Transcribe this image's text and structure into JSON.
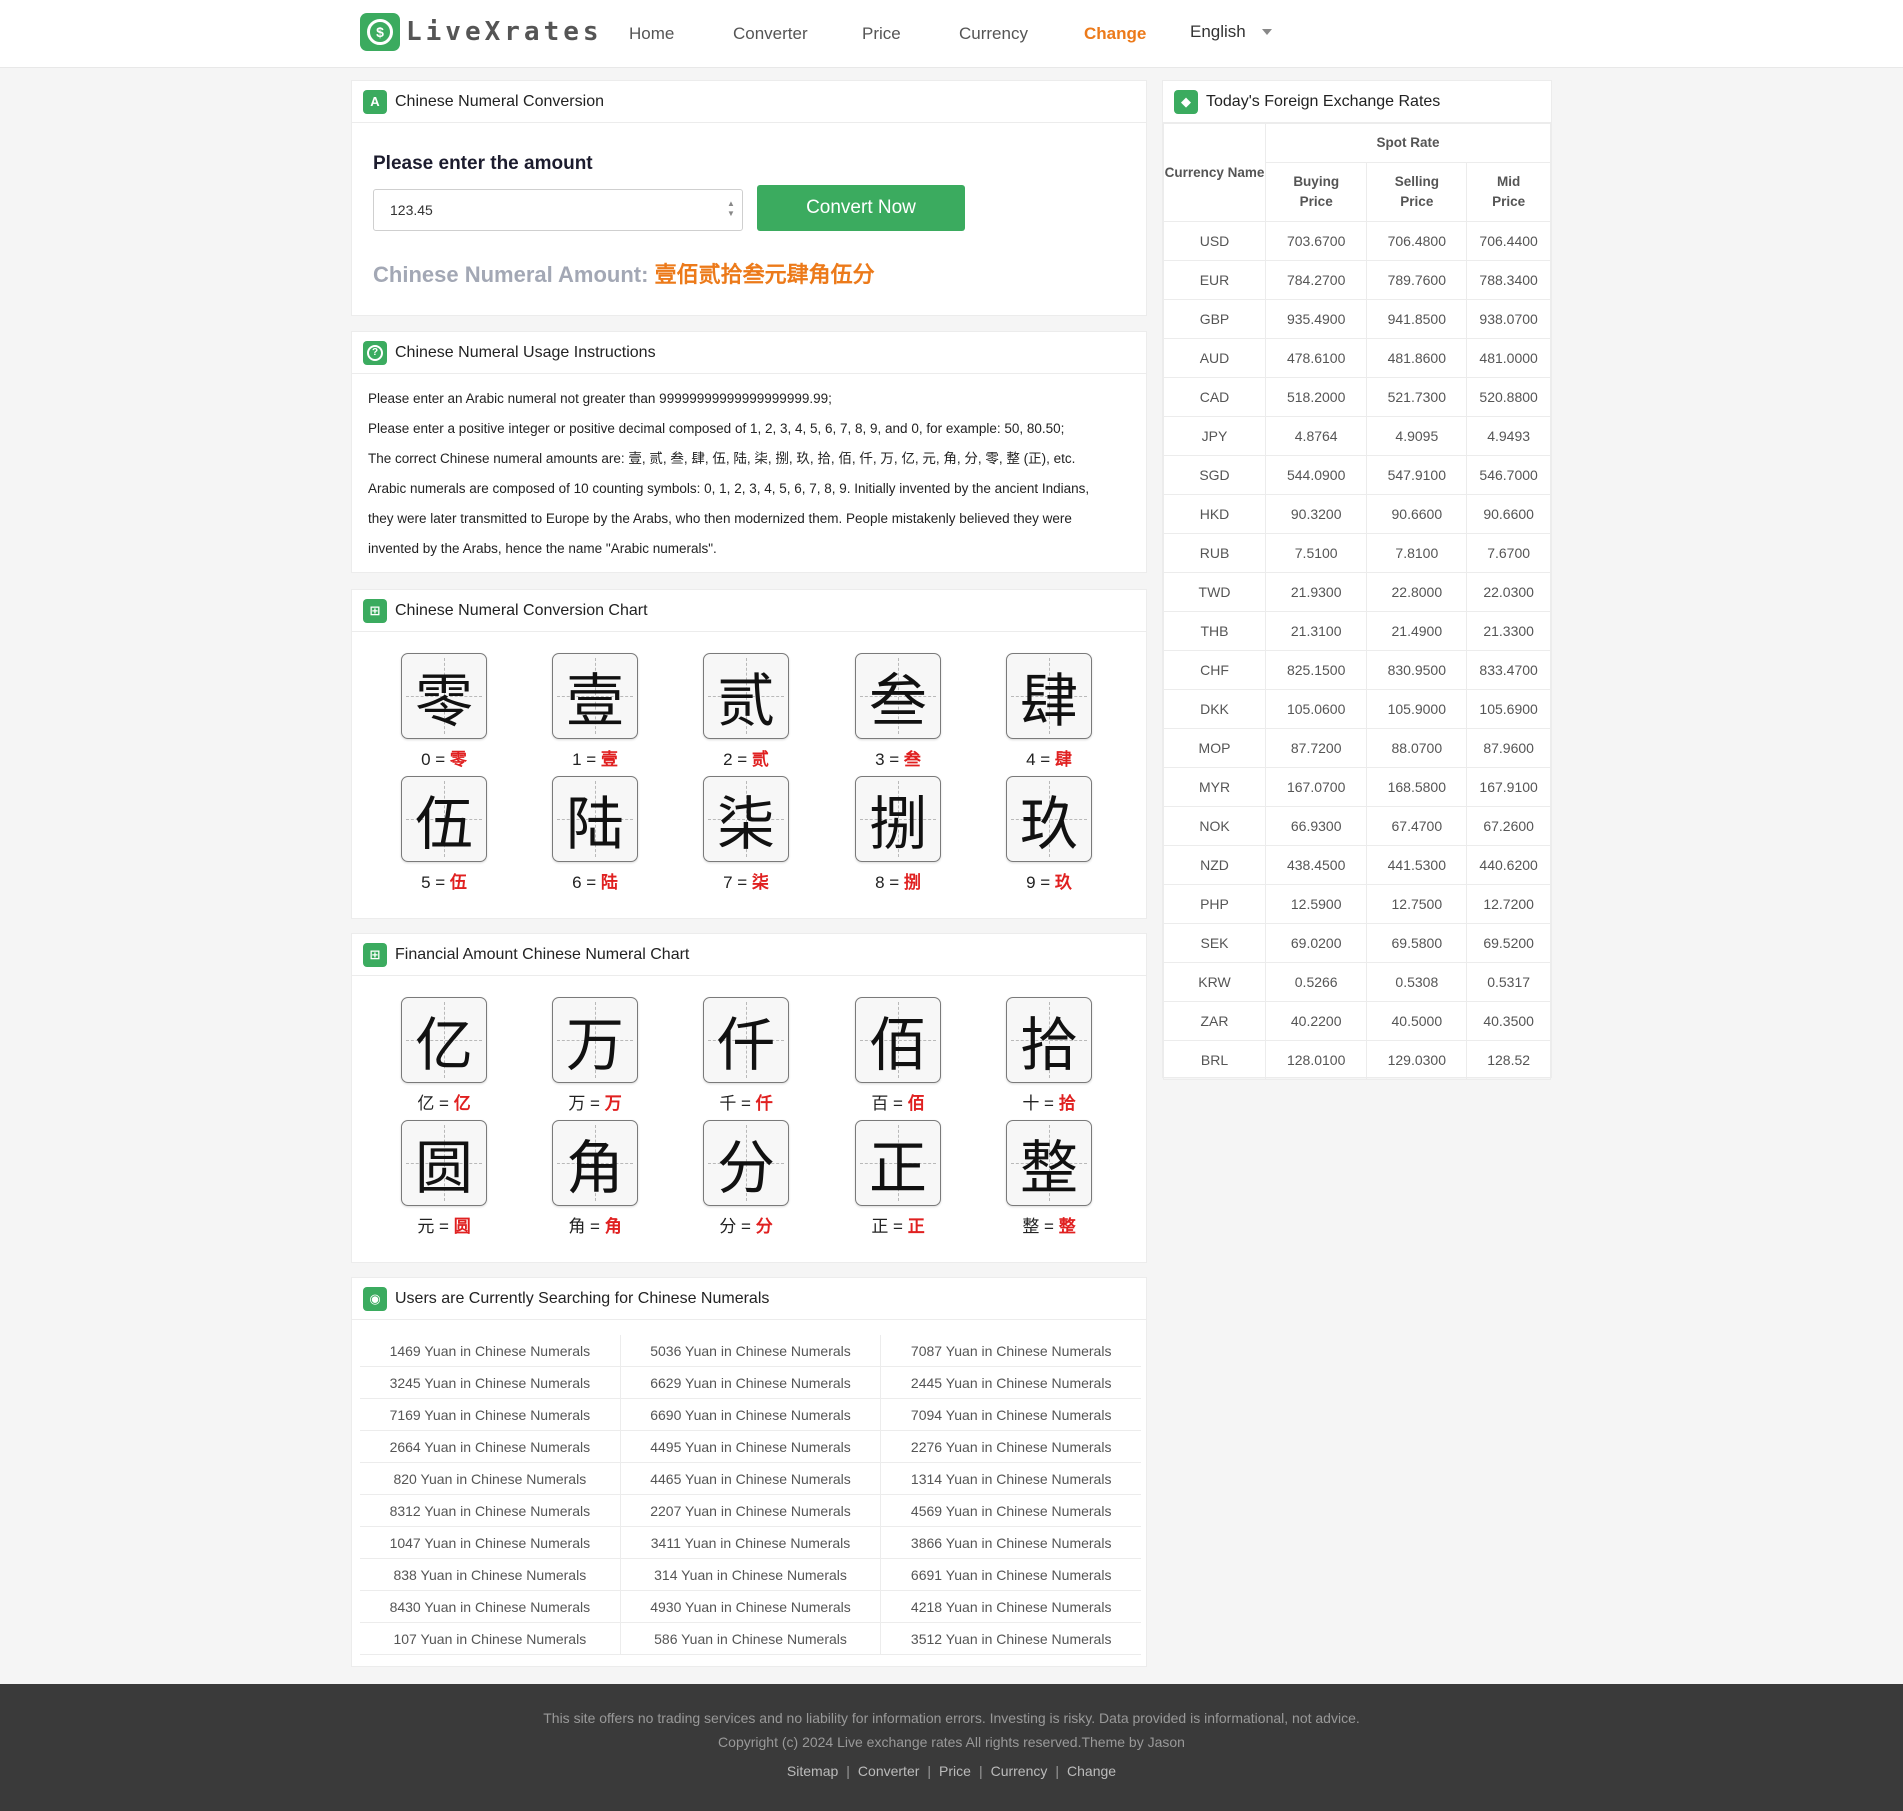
{
  "brand": {
    "name": "LiveXrates"
  },
  "nav": {
    "items": [
      {
        "label": "Home"
      },
      {
        "label": "Converter"
      },
      {
        "label": "Price"
      },
      {
        "label": "Currency"
      },
      {
        "label": "Change"
      }
    ],
    "active": "Change",
    "language": "English"
  },
  "converter": {
    "title": "Chinese Numeral Conversion",
    "prompt": "Please enter the amount",
    "input_value": "123.45",
    "button_label": "Convert Now",
    "result_label": "Chinese Numeral Amount:",
    "result_value": "壹佰贰拾叁元肆角伍分"
  },
  "instructions": {
    "title": "Chinese Numeral Usage Instructions",
    "lines": [
      "Please enter an Arabic numeral not greater than 99999999999999999999.99;",
      "Please enter a positive integer or positive decimal composed of 1, 2, 3, 4, 5, 6, 7, 8, 9, and 0, for example: 50, 80.50;",
      "The correct Chinese numeral amounts are: 壹, 贰, 叁, 肆, 伍, 陆, 柒, 捌, 玖, 拾, 佰, 仟, 万, 亿, 元, 角, 分, 零, 整 (正), etc.",
      "Arabic numerals are composed of 10 counting symbols: 0, 1, 2, 3, 4, 5, 6, 7, 8, 9. Initially invented by the ancient Indians,",
      "they were later transmitted to Europe by the Arabs, who then modernized them. People mistakenly believed they were",
      "invented by the Arabs, hence the name \"Arabic numerals\"."
    ]
  },
  "numeral_chart": {
    "title": "Chinese Numeral Conversion Chart",
    "items": [
      {
        "char": "零",
        "key": "0",
        "val": "零"
      },
      {
        "char": "壹",
        "key": "1",
        "val": "壹"
      },
      {
        "char": "贰",
        "key": "2",
        "val": "贰"
      },
      {
        "char": "叁",
        "key": "3",
        "val": "叁"
      },
      {
        "char": "肆",
        "key": "4",
        "val": "肆"
      },
      {
        "char": "伍",
        "key": "5",
        "val": "伍"
      },
      {
        "char": "陆",
        "key": "6",
        "val": "陆"
      },
      {
        "char": "柒",
        "key": "7",
        "val": "柒"
      },
      {
        "char": "捌",
        "key": "8",
        "val": "捌"
      },
      {
        "char": "玖",
        "key": "9",
        "val": "玖"
      }
    ]
  },
  "financial_chart": {
    "title": "Financial Amount Chinese Numeral Chart",
    "items": [
      {
        "char": "亿",
        "key": "亿",
        "val": "亿"
      },
      {
        "char": "万",
        "key": "万",
        "val": "万"
      },
      {
        "char": "仟",
        "key": "千",
        "val": "仟"
      },
      {
        "char": "佰",
        "key": "百",
        "val": "佰"
      },
      {
        "char": "拾",
        "key": "十",
        "val": "拾"
      },
      {
        "char": "圆",
        "key": "元",
        "val": "圆"
      },
      {
        "char": "角",
        "key": "角",
        "val": "角"
      },
      {
        "char": "分",
        "key": "分",
        "val": "分"
      },
      {
        "char": "正",
        "key": "正",
        "val": "正"
      },
      {
        "char": "整",
        "key": "整",
        "val": "整"
      }
    ]
  },
  "searches": {
    "title": "Users are Currently Searching for Chinese Numerals",
    "rows": [
      [
        "1469 Yuan in Chinese Numerals",
        "5036 Yuan in Chinese Numerals",
        "7087 Yuan in Chinese Numerals"
      ],
      [
        "3245 Yuan in Chinese Numerals",
        "6629 Yuan in Chinese Numerals",
        "2445 Yuan in Chinese Numerals"
      ],
      [
        "7169 Yuan in Chinese Numerals",
        "6690 Yuan in Chinese Numerals",
        "7094 Yuan in Chinese Numerals"
      ],
      [
        "2664 Yuan in Chinese Numerals",
        "4495 Yuan in Chinese Numerals",
        "2276 Yuan in Chinese Numerals"
      ],
      [
        "820 Yuan in Chinese Numerals",
        "4465 Yuan in Chinese Numerals",
        "1314 Yuan in Chinese Numerals"
      ],
      [
        "8312 Yuan in Chinese Numerals",
        "2207 Yuan in Chinese Numerals",
        "4569 Yuan in Chinese Numerals"
      ],
      [
        "1047 Yuan in Chinese Numerals",
        "3411 Yuan in Chinese Numerals",
        "3866 Yuan in Chinese Numerals"
      ],
      [
        "838 Yuan in Chinese Numerals",
        "314 Yuan in Chinese Numerals",
        "6691 Yuan in Chinese Numerals"
      ],
      [
        "8430 Yuan in Chinese Numerals",
        "4930 Yuan in Chinese Numerals",
        "4218 Yuan in Chinese Numerals"
      ],
      [
        "107 Yuan in Chinese Numerals",
        "586 Yuan in Chinese Numerals",
        "3512 Yuan in Chinese Numerals"
      ]
    ]
  },
  "rates": {
    "title": "Today's Foreign Exchange Rates",
    "headers": {
      "currency_name": "Currency Name",
      "spot_rate": "Spot Rate",
      "buying": "Buying Price",
      "selling": "Selling Price",
      "mid": "Mid Price"
    },
    "rows": [
      [
        "USD",
        "703.6700",
        "706.4800",
        "706.4400"
      ],
      [
        "EUR",
        "784.2700",
        "789.7600",
        "788.3400"
      ],
      [
        "GBP",
        "935.4900",
        "941.8500",
        "938.0700"
      ],
      [
        "AUD",
        "478.6100",
        "481.8600",
        "481.0000"
      ],
      [
        "CAD",
        "518.2000",
        "521.7300",
        "520.8800"
      ],
      [
        "JPY",
        "4.8764",
        "4.9095",
        "4.9493"
      ],
      [
        "SGD",
        "544.0900",
        "547.9100",
        "546.7000"
      ],
      [
        "HKD",
        "90.3200",
        "90.6600",
        "90.6600"
      ],
      [
        "RUB",
        "7.5100",
        "7.8100",
        "7.6700"
      ],
      [
        "TWD",
        "21.9300",
        "22.8000",
        "22.0300"
      ],
      [
        "THB",
        "21.3100",
        "21.4900",
        "21.3300"
      ],
      [
        "CHF",
        "825.1500",
        "830.9500",
        "833.4700"
      ],
      [
        "DKK",
        "105.0600",
        "105.9000",
        "105.6900"
      ],
      [
        "MOP",
        "87.7200",
        "88.0700",
        "87.9600"
      ],
      [
        "MYR",
        "167.0700",
        "168.5800",
        "167.9100"
      ],
      [
        "NOK",
        "66.9300",
        "67.4700",
        "67.2600"
      ],
      [
        "NZD",
        "438.4500",
        "441.5300",
        "440.6200"
      ],
      [
        "PHP",
        "12.5900",
        "12.7500",
        "12.7200"
      ],
      [
        "SEK",
        "69.0200",
        "69.5800",
        "69.5200"
      ],
      [
        "KRW",
        "0.5266",
        "0.5308",
        "0.5317"
      ],
      [
        "ZAR",
        "40.2200",
        "40.5000",
        "40.3500"
      ],
      [
        "BRL",
        "128.0100",
        "129.0300",
        "128.52"
      ]
    ]
  },
  "footer": {
    "disclaimer": "This site offers no trading services and no liability for information errors. Investing is risky. Data provided is informational, not advice.",
    "copyright": "Copyright (c) 2024 Live exchange rates All rights reserved.Theme by  Jason",
    "links": [
      {
        "label": "Sitemap"
      },
      {
        "label": "Converter"
      },
      {
        "label": "Price"
      },
      {
        "label": "Currency"
      },
      {
        "label": "Change"
      }
    ]
  },
  "colors": {
    "accent_green": "#3bab5f",
    "accent_orange": "#ec7a1a",
    "red": "#e02020",
    "footer_bg": "#3a3a3a"
  }
}
